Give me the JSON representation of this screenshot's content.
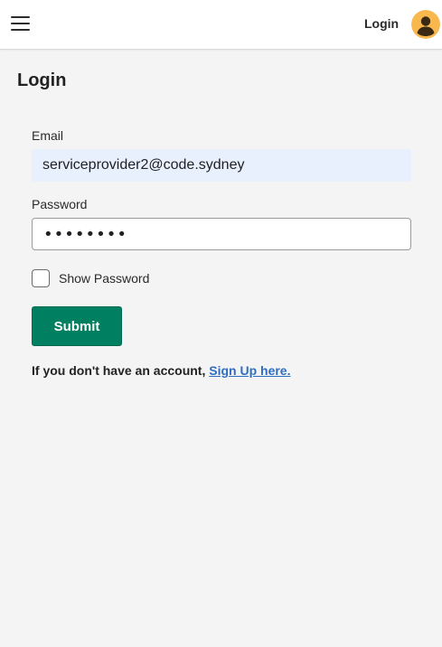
{
  "header": {
    "menu_icon": "hamburger-menu-icon",
    "login_label": "Login",
    "avatar_icon": "user-avatar-icon",
    "avatar_color": "#f8b84e"
  },
  "page": {
    "title": "Login"
  },
  "form": {
    "email_label": "Email",
    "email_value": "serviceprovider2@code.sydney",
    "password_label": "Password",
    "password_value": "••••••••",
    "show_password_label": "Show Password",
    "show_password_checked": false,
    "submit_label": "Submit",
    "submit_color": "#008060",
    "signup_prefix": "If you don't have an account,",
    "signup_link": "Sign Up here."
  }
}
